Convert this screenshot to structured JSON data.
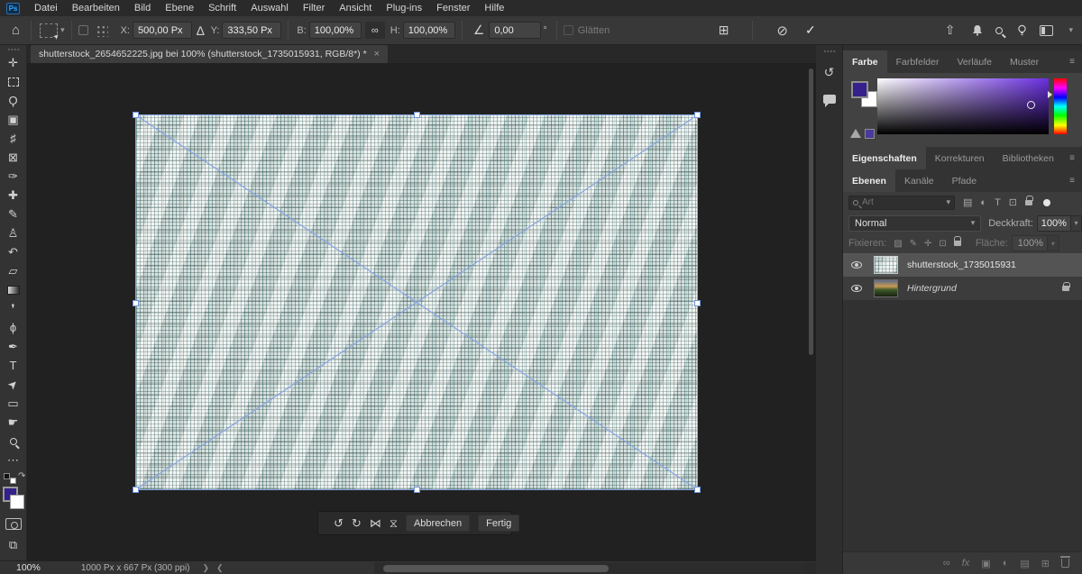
{
  "app": {
    "logo": "Ps"
  },
  "menu_bar": {
    "items": [
      "Datei",
      "Bearbeiten",
      "Bild",
      "Ebene",
      "Schrift",
      "Auswahl",
      "Filter",
      "Ansicht",
      "Plug-ins",
      "Fenster",
      "Hilfe"
    ]
  },
  "options_bar": {
    "fields": {
      "x_label": "X:",
      "x_value": "500,00 Px",
      "y_label": "Y:",
      "y_value": "333,50 Px",
      "w_label": "B:",
      "w_value": "100,00%",
      "h_label": "H:",
      "h_value": "100,00%",
      "angle_value": "0,00",
      "angle_unit": "°",
      "smooth_label": "Glätten"
    },
    "icons": {
      "home": "⌂",
      "chevron": "▾",
      "delta": "∆",
      "link": "∞",
      "angle": "∠",
      "warp": "⊞",
      "cancel": "⊘",
      "commit": "✓",
      "share": "⇧"
    }
  },
  "document": {
    "tab_title": "shutterstock_2654652225.jpg bei 100% (shutterstock_1735015931, RGB/8*) *",
    "close": "×"
  },
  "toolbar": {
    "tools": [
      {
        "name": "move",
        "glyph": "✛"
      },
      {
        "name": "marquee",
        "glyph": ""
      },
      {
        "name": "lasso",
        "glyph": "Ϙ"
      },
      {
        "name": "object-selection",
        "glyph": "▣"
      },
      {
        "name": "crop",
        "glyph": "♯"
      },
      {
        "name": "frame",
        "glyph": "⊠"
      },
      {
        "name": "eyedropper",
        "glyph": "✑"
      },
      {
        "name": "healing-brush",
        "glyph": "✚"
      },
      {
        "name": "brush",
        "glyph": "✎"
      },
      {
        "name": "clone-stamp",
        "glyph": "♙"
      },
      {
        "name": "history-brush",
        "glyph": "↶"
      },
      {
        "name": "eraser",
        "glyph": "▱"
      },
      {
        "name": "gradient",
        "glyph": ""
      },
      {
        "name": "blur",
        "glyph": "❜"
      },
      {
        "name": "dodge",
        "glyph": "ϕ"
      },
      {
        "name": "pen",
        "glyph": "✒"
      },
      {
        "name": "type",
        "glyph": "T"
      },
      {
        "name": "path-selection",
        "glyph": "➤"
      },
      {
        "name": "shape",
        "glyph": "▭"
      },
      {
        "name": "hand",
        "glyph": "☛"
      },
      {
        "name": "zoom",
        "glyph": ""
      },
      {
        "name": "more",
        "glyph": "⋯"
      }
    ],
    "swap_arrow": "↷",
    "screen_mode": "⧉",
    "foreground_color": "#35208c",
    "background_color": "#ffffff"
  },
  "canvas": {
    "transform_bar": {
      "icons": {
        "rotate_ccw": "↺",
        "rotate_cw": "↻",
        "flip_h": "⋈",
        "flip_v": "⧖"
      },
      "cancel": "Abbrechen",
      "done": "Fertig"
    }
  },
  "dock": {
    "strip_icons": {
      "history": "↺"
    }
  },
  "panels": {
    "color": {
      "tabs": [
        "Farbe",
        "Farbfelder",
        "Verläufe",
        "Muster"
      ],
      "active_tab": "Farbe",
      "menu": "≡",
      "foreground_color": "#35208c",
      "background_color": "#ffffff"
    },
    "properties": {
      "tabs": [
        "Eigenschaften",
        "Korrekturen",
        "Bibliotheken"
      ],
      "active_tab": "Eigenschaften",
      "menu": "≡"
    },
    "layers_tabs": {
      "tabs": [
        "Ebenen",
        "Kanäle",
        "Pfade"
      ],
      "active_tab": "Ebenen",
      "menu": "≡"
    },
    "layers": {
      "search_placeholder": "Art",
      "filter_icons": {
        "pixel": "▤",
        "adjustment": "◐",
        "type": "T",
        "shape": "⊡"
      },
      "blend_mode": "Normal",
      "opacity_label": "Deckkraft:",
      "opacity_value": "100%",
      "lock_label": "Fixieren:",
      "lock_icons": {
        "transparency": "▨",
        "pixels": "✎",
        "position": "✛",
        "artboard": "⊡"
      },
      "fill_label": "Fläche:",
      "fill_value": "100%",
      "chevron": "▾",
      "layers": [
        {
          "name": "shutterstock_1735015931",
          "selected": true
        },
        {
          "name": "Hintergrund",
          "selected": false,
          "locked": true
        }
      ],
      "footer_icons": {
        "link": "∞",
        "fx": "fx",
        "mask": "▣",
        "adjustment": "◐",
        "group": "▤",
        "new_layer": "⊞"
      }
    }
  },
  "status_bar": {
    "zoom": "100%",
    "doc_info": "1000 Px x 667 Px (300 ppi)",
    "next": "❯",
    "prev": "❮"
  }
}
